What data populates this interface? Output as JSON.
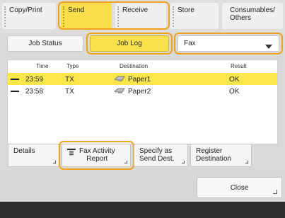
{
  "tabs": [
    {
      "label": "Copy/Print",
      "active": false
    },
    {
      "label": "Send",
      "active": true
    },
    {
      "label": "Receive",
      "active": false
    },
    {
      "label": "Store",
      "active": false
    },
    {
      "label": "Consumables/\nOthers",
      "active": false
    }
  ],
  "toolbar": {
    "job_status": "Job Status",
    "job_log": "Job Log",
    "filter_value": "Fax"
  },
  "table": {
    "headers": {
      "time": "Time",
      "type": "Type",
      "destination": "Destination",
      "result": "Result"
    },
    "rows": [
      {
        "time": "23:59",
        "type": "TX",
        "destination": "Paper1",
        "result": "OK",
        "selected": true
      },
      {
        "time": "23:58",
        "type": "TX",
        "destination": "Paper2",
        "result": "OK",
        "selected": false
      }
    ]
  },
  "actions": {
    "details": "Details",
    "fax_activity_report": "Fax Activity\nReport",
    "specify_send_dest": "Specify as\nSend Dest.",
    "register_destination": "Register\nDestination"
  },
  "close_label": "Close",
  "colors": {
    "accent": "#f9e24b",
    "highlight_outline": "#f0a21f"
  }
}
